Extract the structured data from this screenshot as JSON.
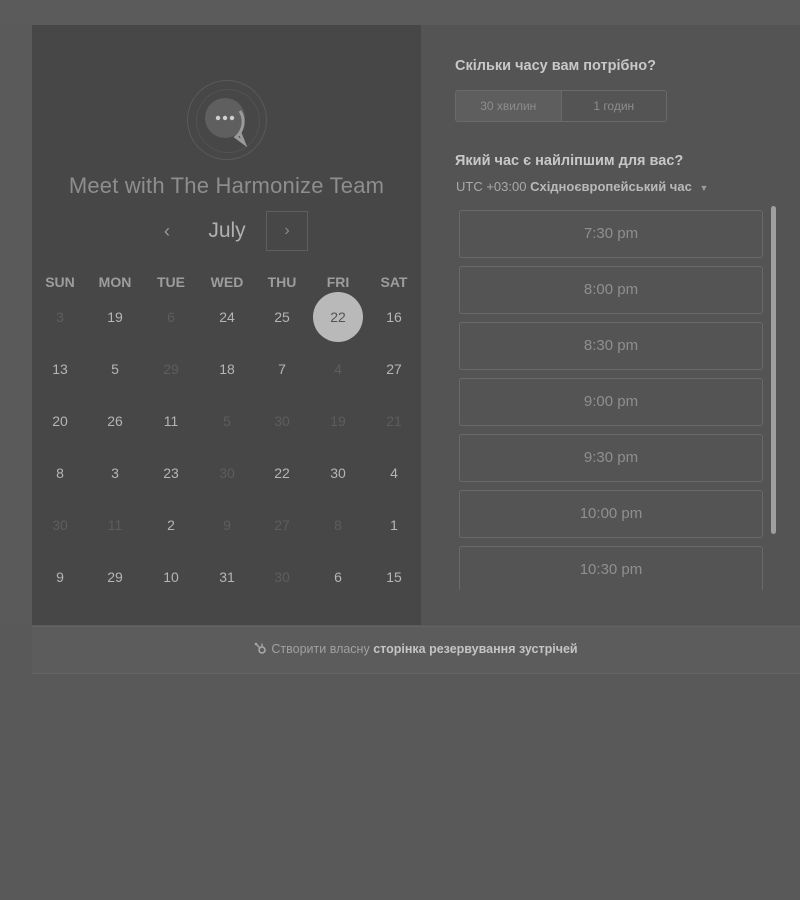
{
  "calendar": {
    "title": "Meet with The Harmonize Team",
    "month": "July",
    "prev_icon": "chevron-left-icon",
    "next_icon": "chevron-right-icon",
    "weekdays": [
      "SUN",
      "MON",
      "TUE",
      "WED",
      "THU",
      "FRI",
      "SAT"
    ],
    "weeks": [
      [
        {
          "d": "3",
          "a": false
        },
        {
          "d": "19",
          "a": true
        },
        {
          "d": "6",
          "a": false
        },
        {
          "d": "24",
          "a": true
        },
        {
          "d": "25",
          "a": true
        },
        {
          "d": "22",
          "a": true,
          "s": true
        },
        {
          "d": "16",
          "a": true
        }
      ],
      [
        {
          "d": "13",
          "a": true
        },
        {
          "d": "5",
          "a": true
        },
        {
          "d": "29",
          "a": false
        },
        {
          "d": "18",
          "a": true
        },
        {
          "d": "7",
          "a": true
        },
        {
          "d": "4",
          "a": false
        },
        {
          "d": "27",
          "a": true
        }
      ],
      [
        {
          "d": "20",
          "a": true
        },
        {
          "d": "26",
          "a": true
        },
        {
          "d": "11",
          "a": true
        },
        {
          "d": "5",
          "a": false
        },
        {
          "d": "30",
          "a": false
        },
        {
          "d": "19",
          "a": false
        },
        {
          "d": "21",
          "a": false
        }
      ],
      [
        {
          "d": "8",
          "a": true
        },
        {
          "d": "3",
          "a": true
        },
        {
          "d": "23",
          "a": true
        },
        {
          "d": "30",
          "a": false
        },
        {
          "d": "22",
          "a": true
        },
        {
          "d": "30",
          "a": true
        },
        {
          "d": "4",
          "a": true
        }
      ],
      [
        {
          "d": "30",
          "a": false
        },
        {
          "d": "11",
          "a": false
        },
        {
          "d": "2",
          "a": true
        },
        {
          "d": "9",
          "a": false
        },
        {
          "d": "27",
          "a": false
        },
        {
          "d": "8",
          "a": false
        },
        {
          "d": "1",
          "a": true
        }
      ],
      [
        {
          "d": "9",
          "a": true
        },
        {
          "d": "29",
          "a": true
        },
        {
          "d": "10",
          "a": true
        },
        {
          "d": "31",
          "a": true
        },
        {
          "d": "30",
          "a": false
        },
        {
          "d": "6",
          "a": true
        },
        {
          "d": "15",
          "a": true
        }
      ]
    ]
  },
  "booking": {
    "duration_question": "Скільки часу вам потрібно?",
    "durations": [
      "30 хвилин",
      "1 годин"
    ],
    "time_question": "Який час є найліпшим для вас?",
    "timezone_offset": "UTC +03:00",
    "timezone_name": "Східноєвропейський час",
    "slots": [
      "7:30 pm",
      "8:00 pm",
      "8:30 pm",
      "9:00 pm",
      "9:30 pm",
      "10:00 pm",
      "10:30 pm"
    ]
  },
  "footer": {
    "prefix": "Створити власну",
    "link_text": "сторінка резервування зустрічей",
    "icon": "sprocket-icon"
  }
}
